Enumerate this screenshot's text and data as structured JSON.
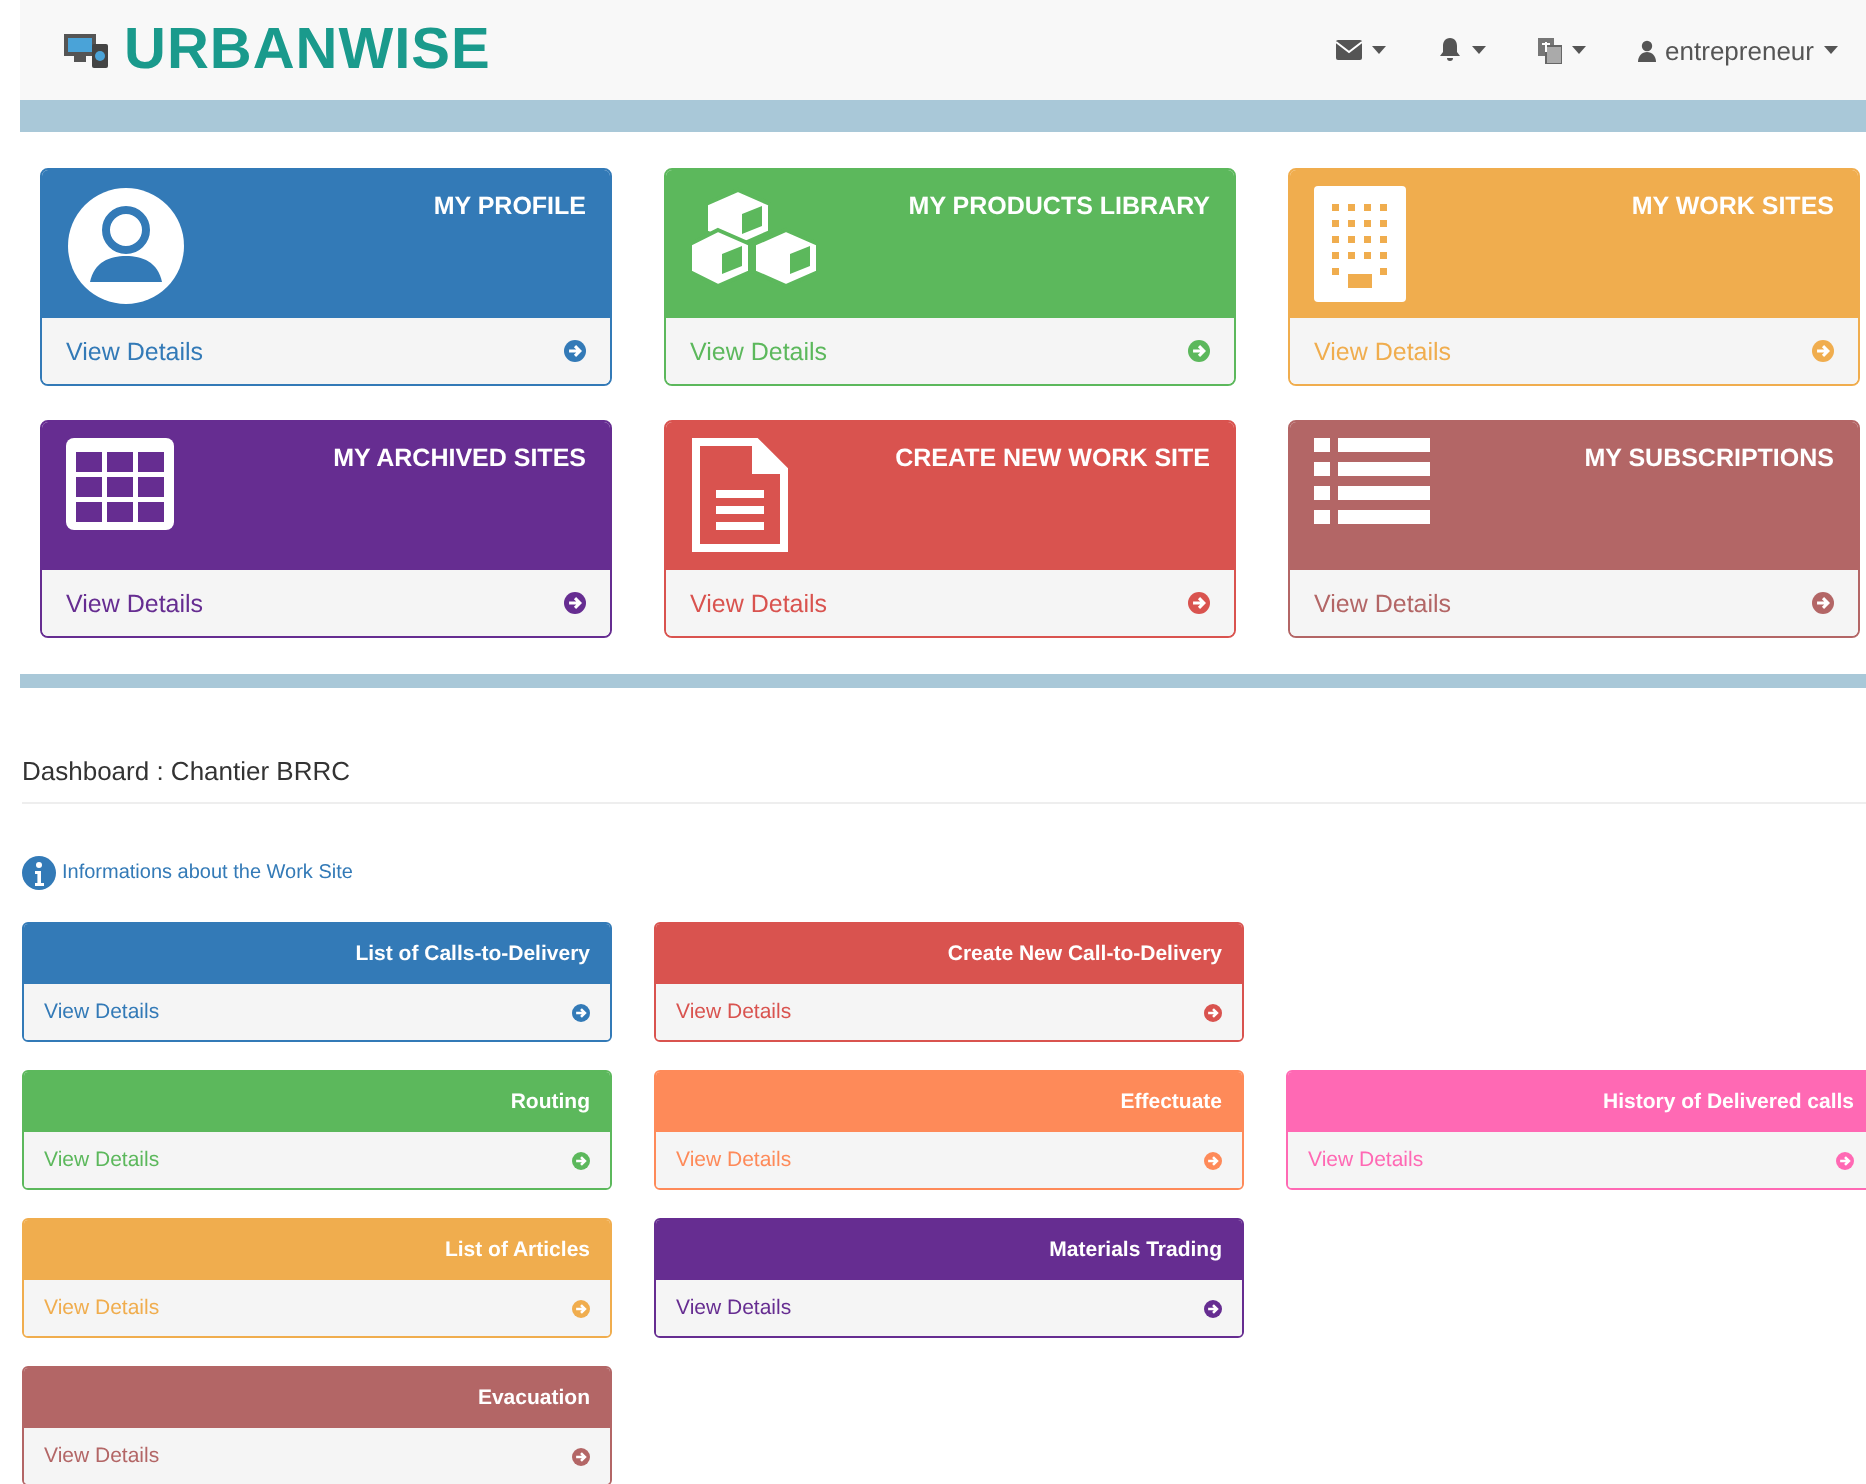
{
  "header": {
    "logo": "URBANWISE",
    "nav": [
      {
        "kind": "mail"
      },
      {
        "kind": "bell"
      },
      {
        "kind": "translate"
      },
      {
        "kind": "user",
        "label": "entrepreneur"
      }
    ]
  },
  "top_panels": [
    {
      "title": "MY PROFILE",
      "link": "View Details",
      "color": "#337ab7"
    },
    {
      "title": "MY PRODUCTS LIBRARY",
      "link": "View Details",
      "color": "#5cb85c"
    },
    {
      "title": "MY WORK SITES",
      "link": "View Details",
      "color": "#f0ad4e"
    },
    {
      "title": "MY ARCHIVED SITES",
      "link": "View Details",
      "color": "#662d91"
    },
    {
      "title": "CREATE NEW WORK SITE",
      "link": "View Details",
      "color": "#d9534f"
    },
    {
      "title": "MY SUBSCRIPTIONS",
      "link": "View Details",
      "color": "#b36666"
    }
  ],
  "dashboard_title": "Dashboard : Chantier BRRC",
  "info_link": "Informations about the Work Site",
  "panel_rows": [
    [
      {
        "title": "List of Calls-to-Delivery",
        "link": "View Details",
        "color": "#337ab7"
      },
      {
        "title": "Create New Call-to-Delivery",
        "link": "View Details",
        "color": "#d9534f"
      }
    ],
    [
      {
        "title": "Routing",
        "link": "View Details",
        "color": "#5cb85c"
      },
      {
        "title": "Effectuate",
        "link": "View Details",
        "color": "#fe8a59"
      },
      {
        "title": "History of Delivered calls",
        "link": "View Details",
        "color": "#ff69b4"
      }
    ],
    [
      {
        "title": "List of Articles",
        "link": "View Details",
        "color": "#f0ad4e"
      },
      {
        "title": "Materials Trading",
        "link": "View Details",
        "color": "#662d91"
      }
    ],
    [
      {
        "title": "Evacuation",
        "link": "View Details",
        "color": "#b36666"
      }
    ]
  ]
}
